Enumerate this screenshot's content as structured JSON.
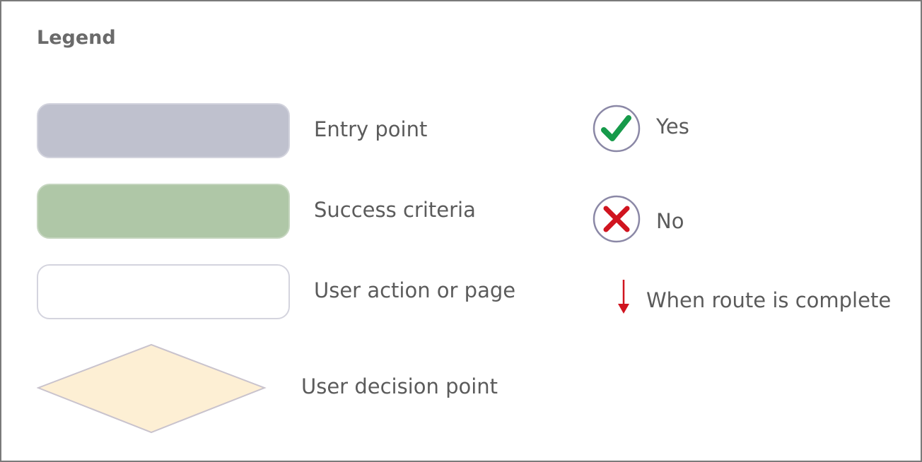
{
  "legend": {
    "title": "Legend",
    "shapes": [
      {
        "name": "entry",
        "label": "Entry point",
        "color": "#bfc1ce"
      },
      {
        "name": "success",
        "label": "Success criteria",
        "color": "#afc7a7"
      },
      {
        "name": "action",
        "label": "User action or page",
        "color": "#ffffff"
      },
      {
        "name": "decision",
        "label": "User decision point",
        "color": "#fdefd4"
      }
    ],
    "symbols": [
      {
        "name": "checkmark-icon",
        "label": "Yes",
        "color": "#169a4a"
      },
      {
        "name": "cross-icon",
        "label": "No",
        "color": "#d0141f"
      },
      {
        "name": "red-down-arrow-icon",
        "label": "When route is complete",
        "color": "#d0141f"
      }
    ]
  }
}
